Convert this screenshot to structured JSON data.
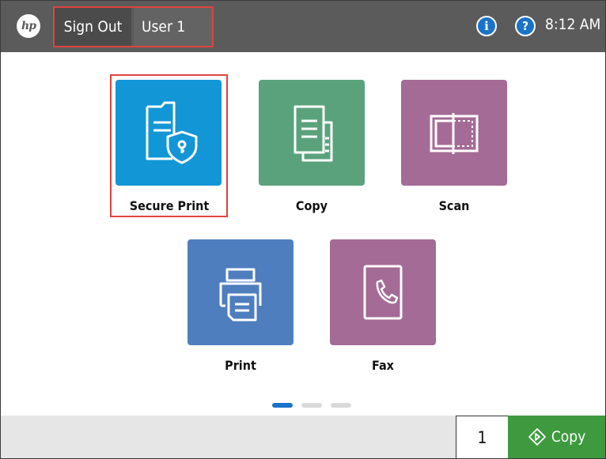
{
  "topbar": {
    "logo_text": "hp",
    "sign_out_label": "Sign Out",
    "user_label": "User 1",
    "info_icon": "info-icon",
    "help_icon": "help-icon",
    "time": "8:12 AM"
  },
  "apps": [
    {
      "label": "Secure Print",
      "icon": "secure-print-icon",
      "color": "#1296d6"
    },
    {
      "label": "Copy",
      "icon": "copy-icon",
      "color": "#5aa27c"
    },
    {
      "label": "Scan",
      "icon": "scan-icon",
      "color": "#a46b96"
    },
    {
      "label": "Print",
      "icon": "print-icon",
      "color": "#4f7ebf"
    },
    {
      "label": "Fax",
      "icon": "fax-icon",
      "color": "#a46b96"
    }
  ],
  "pager": {
    "pages": 3,
    "current": 1,
    "active_color": "#1a73c8",
    "inactive_color": "#d9d9d9"
  },
  "bottombar": {
    "copies": "1",
    "copy_label": "Copy",
    "copy_color": "#3f9a3f"
  }
}
